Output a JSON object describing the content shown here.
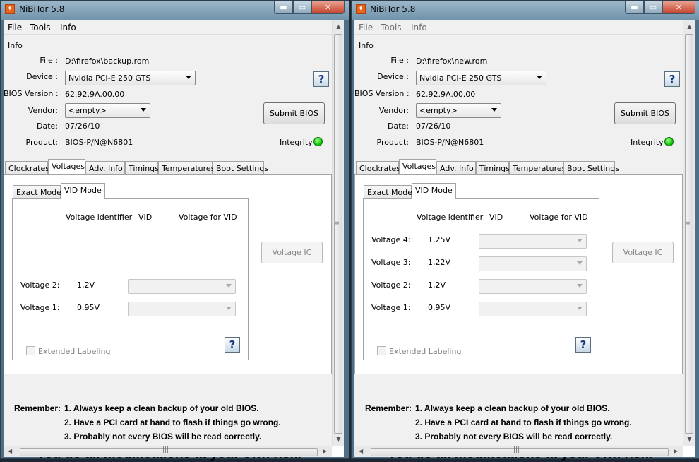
{
  "windows": [
    {
      "title": "NiBiTor 5.8",
      "menu": [
        "File",
        "Tools",
        "Info"
      ],
      "info": {
        "section_label": "Info",
        "file_label": "File :",
        "file_value": "D:\\firefox\\backup.rom",
        "device_label": "Device :",
        "device_value": "Nvidia PCI-E 250 GTS",
        "bios_version_label": "BIOS Version :",
        "bios_version_value": "62.92.9A.00.00",
        "vendor_label": "Vendor:",
        "vendor_value": "<empty>",
        "date_label": "Date:",
        "date_value": "07/26/10",
        "product_label": "Product:",
        "product_value": "BIOS-P/N@N6801",
        "submit_bios": "Submit BIOS",
        "integrity_label": "Integrity :",
        "help": "?"
      },
      "tabs": [
        "Clockrates",
        "Voltages",
        "Adv. Info",
        "Timings",
        "Temperatures",
        "Boot Settings"
      ],
      "subtabs": [
        "Exact Mode",
        "VID Mode"
      ],
      "vid": {
        "col_identifier": "Voltage identifier",
        "col_vid": "VID",
        "col_voltage": "Voltage for VID",
        "rows": [
          {
            "label": "Voltage 2:",
            "value": "1,2V"
          },
          {
            "label": "Voltage 1:",
            "value": "0,95V"
          }
        ],
        "extended_labeling": "Extended Labeling",
        "voltage_ic": "Voltage IC",
        "help": "?"
      },
      "remember": {
        "label": "Remember:",
        "items": [
          "1. Always keep a clean backup of your old BIOS.",
          "2. Have a PCI card at hand to flash if things go wrong.",
          "3. Probably not every BIOS will be read correctly."
        ],
        "risk": "You do all modifications at your own risk!"
      }
    },
    {
      "title": "NiBiTor 5.8",
      "menu": [
        "File",
        "Tools",
        "Info"
      ],
      "info": {
        "section_label": "Info",
        "file_label": "File :",
        "file_value": "D:\\firefox\\new.rom",
        "device_label": "Device :",
        "device_value": "Nvidia PCI-E 250 GTS",
        "bios_version_label": "BIOS Version :",
        "bios_version_value": "62.92.9A.00.00",
        "vendor_label": "Vendor:",
        "vendor_value": "<empty>",
        "date_label": "Date:",
        "date_value": "07/26/10",
        "product_label": "Product:",
        "product_value": "BIOS-P/N@N6801",
        "submit_bios": "Submit BIOS",
        "integrity_label": "Integrity :",
        "help": "?"
      },
      "tabs": [
        "Clockrates",
        "Voltages",
        "Adv. Info",
        "Timings",
        "Temperatures",
        "Boot Settings"
      ],
      "subtabs": [
        "Exact Mode",
        "VID Mode"
      ],
      "vid": {
        "col_identifier": "Voltage identifier",
        "col_vid": "VID",
        "col_voltage": "Voltage for VID",
        "rows": [
          {
            "label": "Voltage 4:",
            "value": "1,25V"
          },
          {
            "label": "Voltage 3:",
            "value": "1,22V"
          },
          {
            "label": "Voltage 2:",
            "value": "1,2V"
          },
          {
            "label": "Voltage 1:",
            "value": "0,95V"
          }
        ],
        "extended_labeling": "Extended Labeling",
        "voltage_ic": "Voltage IC",
        "help": "?"
      },
      "remember": {
        "label": "Remember:",
        "items": [
          "1. Always keep a clean backup of your old BIOS.",
          "2. Have a PCI card at hand to flash if things go wrong.",
          "3. Probably not every BIOS will be read correctly."
        ],
        "risk": "You do all modifications at your own risk!"
      }
    }
  ],
  "colors": {
    "integrity_ok": "#14c80f",
    "title_accent": "#e8641a"
  }
}
